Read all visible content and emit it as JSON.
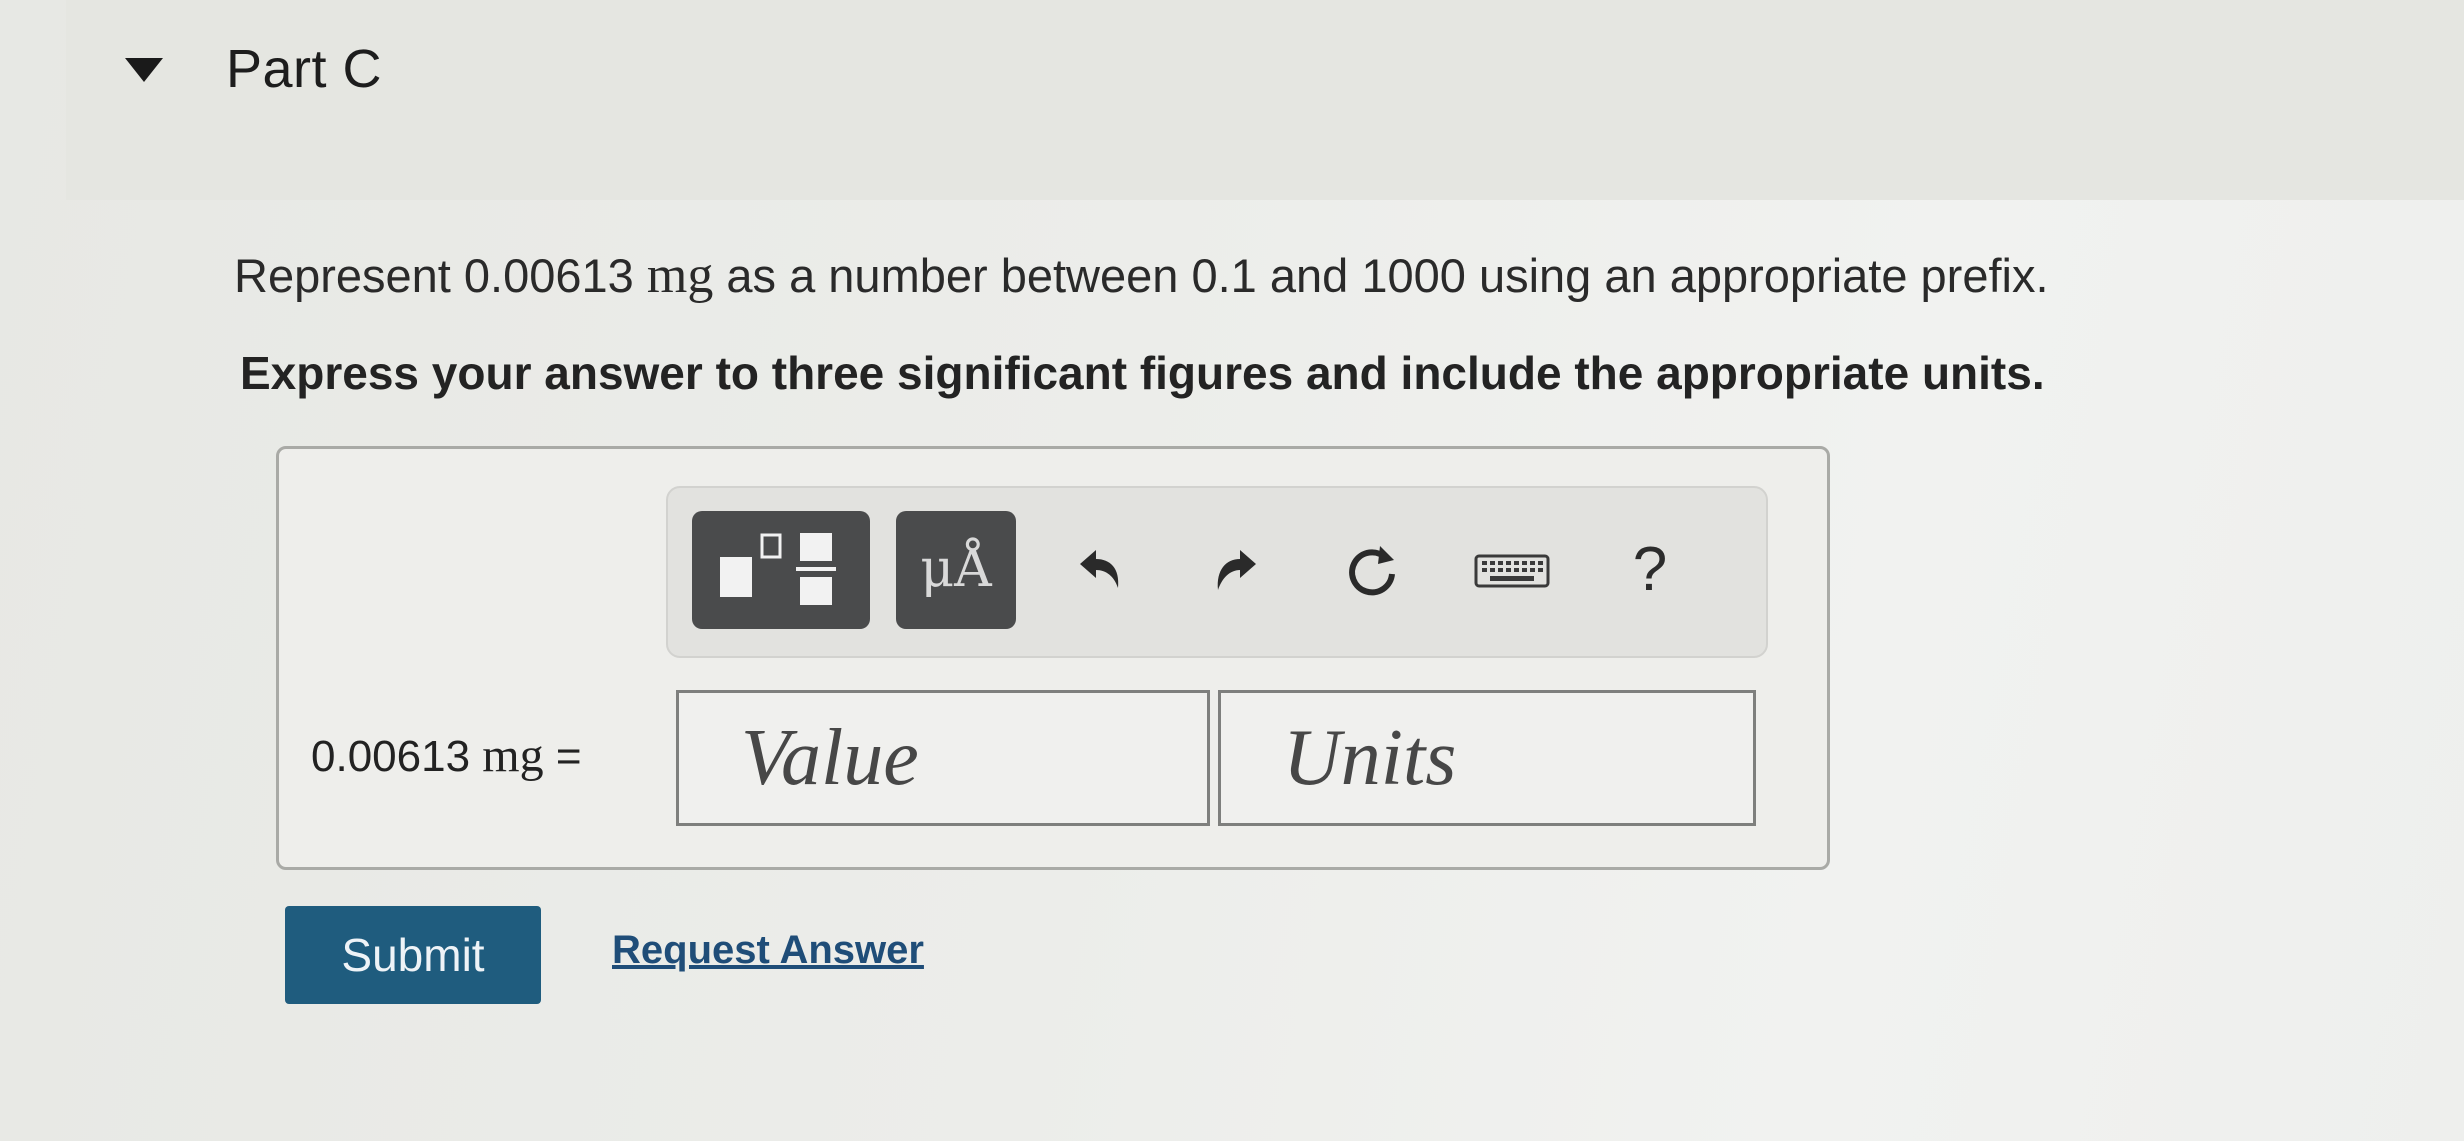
{
  "part": {
    "title": "Part C"
  },
  "question": {
    "prefix_text": "Represent 0.00613",
    "unit": "mg",
    "suffix_text": "as a number between 0.1 and 1000 using an appropriate prefix.",
    "instruction": "Express your answer to three significant figures and include the appropriate units."
  },
  "toolbar": {
    "units_label": "μÅ",
    "help_label": "?",
    "icons": [
      "templates-icon",
      "units-icon",
      "undo-icon",
      "redo-icon",
      "reset-icon",
      "keyboard-icon",
      "help-icon"
    ]
  },
  "answer": {
    "equation_number": "0.00613",
    "equation_unit": "mg",
    "equation_sign": "=",
    "value_placeholder": "Value",
    "units_placeholder": "Units"
  },
  "actions": {
    "submit_label": "Submit",
    "request_answer_label": "Request Answer"
  },
  "colors": {
    "submit_bg": "#1f5c7e",
    "link": "#1f4d78",
    "toolbar_dark_button": "#4a4b4c"
  }
}
